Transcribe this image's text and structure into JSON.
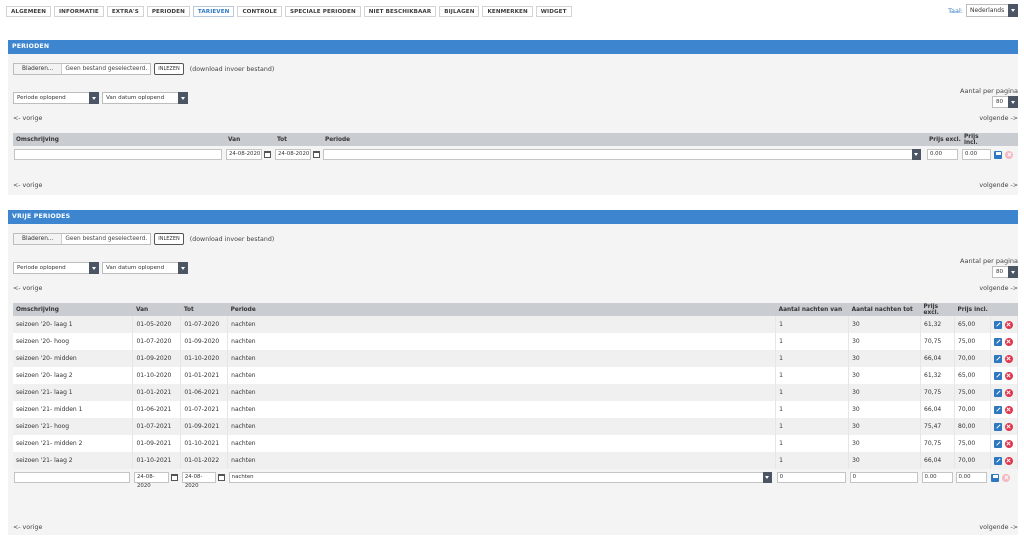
{
  "tabs": [
    {
      "label": "ALGEMEEN",
      "active": false
    },
    {
      "label": "INFORMATIE",
      "active": false
    },
    {
      "label": "EXTRA'S",
      "active": false
    },
    {
      "label": "PERIODEN",
      "active": false
    },
    {
      "label": "TARIEVEN",
      "active": true
    },
    {
      "label": "CONTROLE",
      "active": false
    },
    {
      "label": "SPECIALE PERIODEN",
      "active": false
    },
    {
      "label": "NIET BESCHIKBAAR",
      "active": false
    },
    {
      "label": "BIJLAGEN",
      "active": false
    },
    {
      "label": "KENMERKEN",
      "active": false
    },
    {
      "label": "WIDGET",
      "active": false
    }
  ],
  "language": {
    "label": "Taal:",
    "value": "Nederlands"
  },
  "colors": {
    "accent": "#3d86cf",
    "delete": "#e0344b",
    "header_bg": "#c9ccd1"
  },
  "perioden": {
    "title": "PERIODEN",
    "upload": {
      "browse": "Bladeren...",
      "file_status": "Geen bestand geselecteerd.",
      "import_button": "INLEZEN",
      "download_text": "(download invoer bestand)"
    },
    "sort1": "Periode oplopend",
    "sort2": "Van datum oplopend",
    "per_page_label": "Aantal per pagina",
    "per_page_value": "80",
    "prev": "<- vorige",
    "next": "volgende ->",
    "columns": {
      "omschrijving": "Omschrijving",
      "van": "Van",
      "tot": "Tot",
      "periode": "Periode",
      "prijs_excl": "Prijs excl.",
      "prijs_incl": "Prijs incl."
    },
    "new_row": {
      "omschrijving": "",
      "van": "24-08-2020",
      "tot": "24-08-2020",
      "periode": "",
      "prijs_excl": "0.00",
      "prijs_incl": "0.00"
    }
  },
  "vrije": {
    "title": "VRIJE PERIODES",
    "upload": {
      "browse": "Bladeren...",
      "file_status": "Geen bestand geselecteerd.",
      "import_button": "INLEZEN",
      "download_text": "(download invoer bestand)"
    },
    "sort1": "Periode oplopend",
    "sort2": "Van datum oplopend",
    "per_page_label": "Aantal per pagina",
    "per_page_value": "80",
    "prev": "<- vorige",
    "next": "volgende ->",
    "columns": {
      "omschrijving": "Omschrijving",
      "van": "Van",
      "tot": "Tot",
      "periode": "Periode",
      "nachten_van": "Aantal nachten van",
      "nachten_tot": "Aantal nachten tot",
      "prijs_excl": "Prijs excl.",
      "prijs_incl": "Prijs incl."
    },
    "rows": [
      {
        "omschrijving": "seizoen '20- laag 1",
        "van": "01-05-2020",
        "tot": "01-07-2020",
        "periode": "nachten",
        "nachten_van": "1",
        "nachten_tot": "30",
        "prijs_excl": "61,32",
        "prijs_incl": "65,00"
      },
      {
        "omschrijving": "seizoen '20- hoog",
        "van": "01-07-2020",
        "tot": "01-09-2020",
        "periode": "nachten",
        "nachten_van": "1",
        "nachten_tot": "30",
        "prijs_excl": "70,75",
        "prijs_incl": "75,00"
      },
      {
        "omschrijving": "seizoen '20- midden",
        "van": "01-09-2020",
        "tot": "01-10-2020",
        "periode": "nachten",
        "nachten_van": "1",
        "nachten_tot": "30",
        "prijs_excl": "66,04",
        "prijs_incl": "70,00"
      },
      {
        "omschrijving": "seizoen '20- laag 2",
        "van": "01-10-2020",
        "tot": "01-01-2021",
        "periode": "nachten",
        "nachten_van": "1",
        "nachten_tot": "30",
        "prijs_excl": "61,32",
        "prijs_incl": "65,00"
      },
      {
        "omschrijving": "seizoen '21- laag 1",
        "van": "01-01-2021",
        "tot": "01-06-2021",
        "periode": "nachten",
        "nachten_van": "1",
        "nachten_tot": "30",
        "prijs_excl": "70,75",
        "prijs_incl": "75,00"
      },
      {
        "omschrijving": "seizoen '21- midden 1",
        "van": "01-06-2021",
        "tot": "01-07-2021",
        "periode": "nachten",
        "nachten_van": "1",
        "nachten_tot": "30",
        "prijs_excl": "66,04",
        "prijs_incl": "70,00"
      },
      {
        "omschrijving": "seizoen '21- hoog",
        "van": "01-07-2021",
        "tot": "01-09-2021",
        "periode": "nachten",
        "nachten_van": "1",
        "nachten_tot": "30",
        "prijs_excl": "75,47",
        "prijs_incl": "80,00"
      },
      {
        "omschrijving": "seizoen '21- midden 2",
        "van": "01-09-2021",
        "tot": "01-10-2021",
        "periode": "nachten",
        "nachten_van": "1",
        "nachten_tot": "30",
        "prijs_excl": "70,75",
        "prijs_incl": "75,00"
      },
      {
        "omschrijving": "seizoen '21- laag 2",
        "van": "01-10-2021",
        "tot": "01-01-2022",
        "periode": "nachten",
        "nachten_van": "1",
        "nachten_tot": "30",
        "prijs_excl": "66,04",
        "prijs_incl": "70,00"
      }
    ],
    "new_row": {
      "omschrijving": "",
      "van": "24-08-2020",
      "tot": "24-08-2020",
      "periode": "nachten",
      "nachten_van": "0",
      "nachten_tot": "0",
      "prijs_excl": "0.00",
      "prijs_incl": "0.00"
    }
  }
}
